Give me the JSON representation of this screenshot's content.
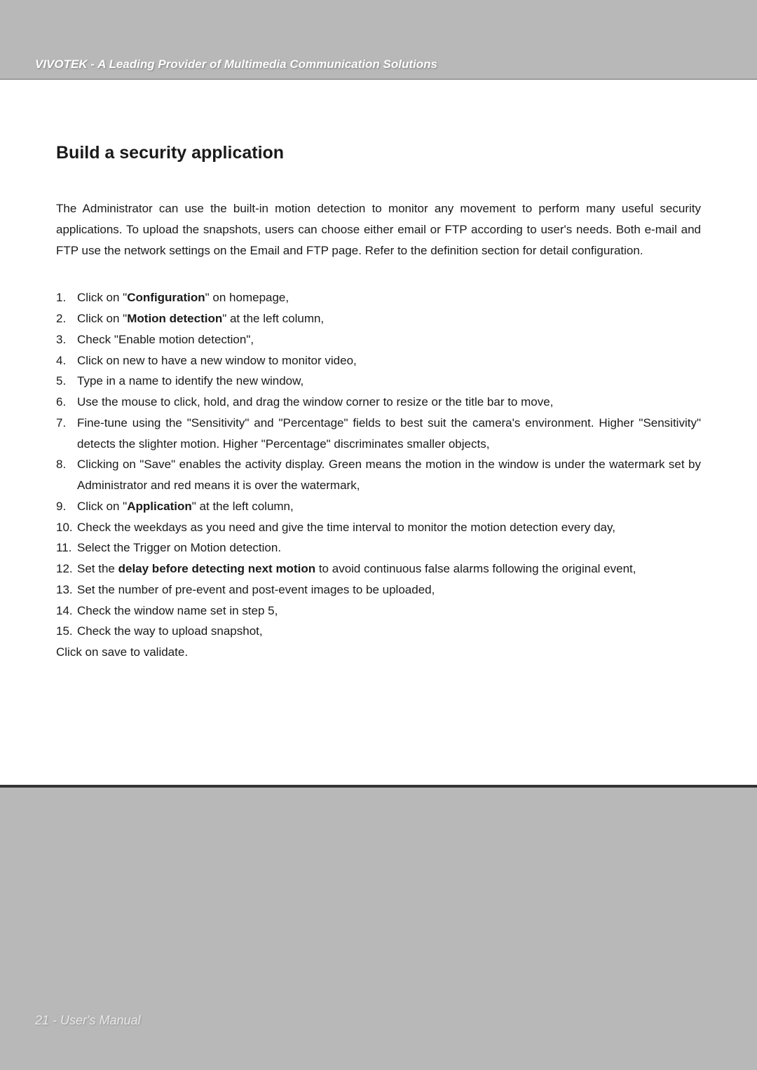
{
  "header": {
    "tagline": "VIVOTEK - A Leading Provider of Multimedia Communication Solutions"
  },
  "main": {
    "title": "Build a security application",
    "intro": "The Administrator can use the built-in motion detection to monitor any movement to perform many useful security applications. To upload the snapshots, users can choose either email or FTP according to user's needs. Both e-mail and FTP use the network settings on the Email and FTP page. Refer to the definition section for detail configuration.",
    "steps": {
      "s1": {
        "num": "1.",
        "pre": "Click on \"",
        "bold": "Configuration",
        "post": "\" on homepage,"
      },
      "s2": {
        "num": "2.",
        "pre": "Click on \"",
        "bold": "Motion detection",
        "post": "\" at the left column,"
      },
      "s3": {
        "num": "3.",
        "text": "Check \"Enable motion detection\","
      },
      "s4": {
        "num": "4.",
        "text": "Click on new to have a new window to monitor video,"
      },
      "s5": {
        "num": "5.",
        "text": "Type in a name to identify the new window,"
      },
      "s6": {
        "num": "6.",
        "text": "Use the mouse to click, hold, and drag the window corner to resize or the title bar to move,"
      },
      "s7": {
        "num": "7.",
        "text": "Fine-tune using the \"Sensitivity\" and \"Percentage\" fields to best suit the camera's environment. Higher \"Sensitivity\" detects the slighter motion. Higher \"Percentage\" discriminates smaller objects,"
      },
      "s8": {
        "num": "8.",
        "text": "Clicking on \"Save\" enables the activity display. Green means the motion in the window is under the watermark set by Administrator and red means it is over the watermark,"
      },
      "s9": {
        "num": "9.",
        "pre": "Click on \"",
        "bold": "Application",
        "post": "\" at the left column,"
      },
      "s10": {
        "num": "10.",
        "text": "Check the weekdays as you need and give the time interval to monitor the motion detection every day,"
      },
      "s11": {
        "num": "11.",
        "text": "Select the Trigger on Motion detection."
      },
      "s12": {
        "num": "12.",
        "pre": "Set the ",
        "bold": "delay before detecting next motion",
        "post": " to avoid continuous false alarms following the original event,"
      },
      "s13": {
        "num": "13.",
        "text": "Set the number of pre-event and post-event images to be uploaded,"
      },
      "s14": {
        "num": "14.",
        "text": "Check the window name set in step 5,"
      },
      "s15": {
        "num": "15.",
        "text": "Check the way to upload snapshot,"
      }
    },
    "closing": "Click on save to validate."
  },
  "footer": {
    "page_label": "21 - User's Manual"
  }
}
